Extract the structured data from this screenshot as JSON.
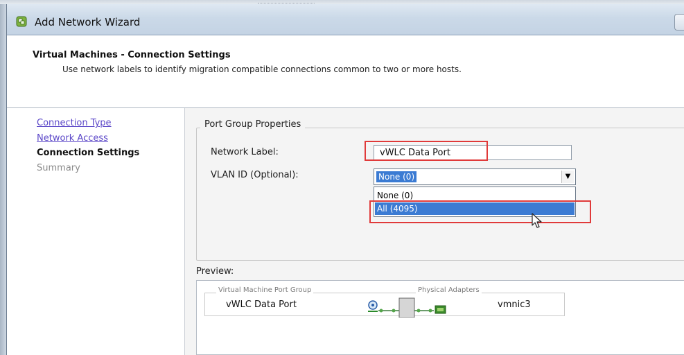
{
  "window": {
    "title": "Add Network Wizard"
  },
  "header": {
    "title": "Virtual Machines - Connection Settings",
    "description": "Use network labels to identify migration compatible connections common to two or more hosts."
  },
  "steps": [
    {
      "label": "Connection Type",
      "state": "link"
    },
    {
      "label": "Network Access",
      "state": "link"
    },
    {
      "label": "Connection Settings",
      "state": "current"
    },
    {
      "label": "Summary",
      "state": "future"
    }
  ],
  "port_group": {
    "legend": "Port Group Properties",
    "network_label": {
      "label": "Network Label:",
      "value": "vWLC Data Port"
    },
    "vlan": {
      "label": "VLAN ID (Optional):",
      "selected": "None (0)",
      "options": [
        "None (0)",
        "All (4095)"
      ],
      "highlighted_option": "All (4095)"
    }
  },
  "preview": {
    "label": "Preview:",
    "vm_group_legend": "Virtual Machine Port Group",
    "physical_legend": "Physical Adapters",
    "port_group_name": "vWLC Data Port",
    "nic_name": "vmnic3"
  },
  "colors": {
    "highlight": "#e03a3a",
    "selection": "#3b7bd3",
    "link": "#5b47c8"
  }
}
